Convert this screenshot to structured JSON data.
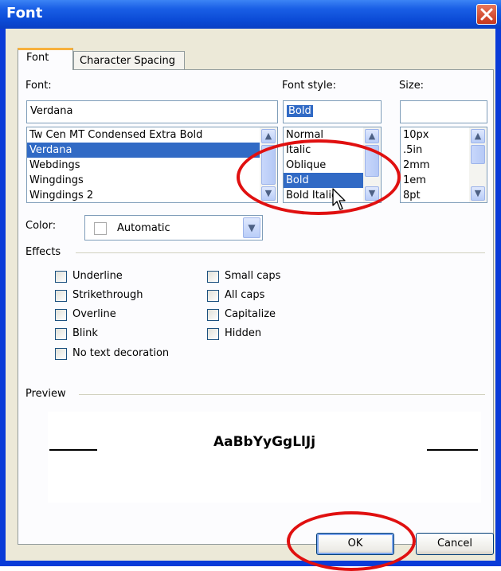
{
  "window": {
    "title": "Font",
    "close_glyph": "✕"
  },
  "tabs": [
    {
      "label": "Font"
    },
    {
      "label": "Character Spacing"
    }
  ],
  "font": {
    "label": "Font:",
    "value": "Verdana",
    "items": [
      "Tw Cen MT Condensed Extra Bold",
      "Verdana",
      "Webdings",
      "Wingdings",
      "Wingdings 2"
    ],
    "selected_index": 1
  },
  "font_style": {
    "label": "Font style:",
    "value": "Bold",
    "items": [
      "Normal",
      "Italic",
      "Oblique",
      "Bold",
      "Bold Italic"
    ],
    "selected_index": 3
  },
  "size": {
    "label": "Size:",
    "value": "",
    "items": [
      "10px",
      ".5in",
      "2mm",
      "1em",
      "8pt"
    ]
  },
  "color": {
    "label": "Color:",
    "value": "Automatic"
  },
  "effects": {
    "label": "Effects",
    "left": [
      "Underline",
      "Strikethrough",
      "Overline",
      "Blink",
      "No text decoration"
    ],
    "right": [
      "Small caps",
      "All caps",
      "Capitalize",
      "Hidden"
    ]
  },
  "preview": {
    "label": "Preview",
    "text": "AaBbYyGgLlJj"
  },
  "buttons": {
    "ok": "OK",
    "cancel": "Cancel"
  },
  "colors": {
    "title_bar": "#0b4bd6",
    "selection": "#316ac5",
    "annotation": "#e01010"
  },
  "icons": {
    "scroll_up": "▲",
    "scroll_down": "▼",
    "dropdown": "▼"
  }
}
